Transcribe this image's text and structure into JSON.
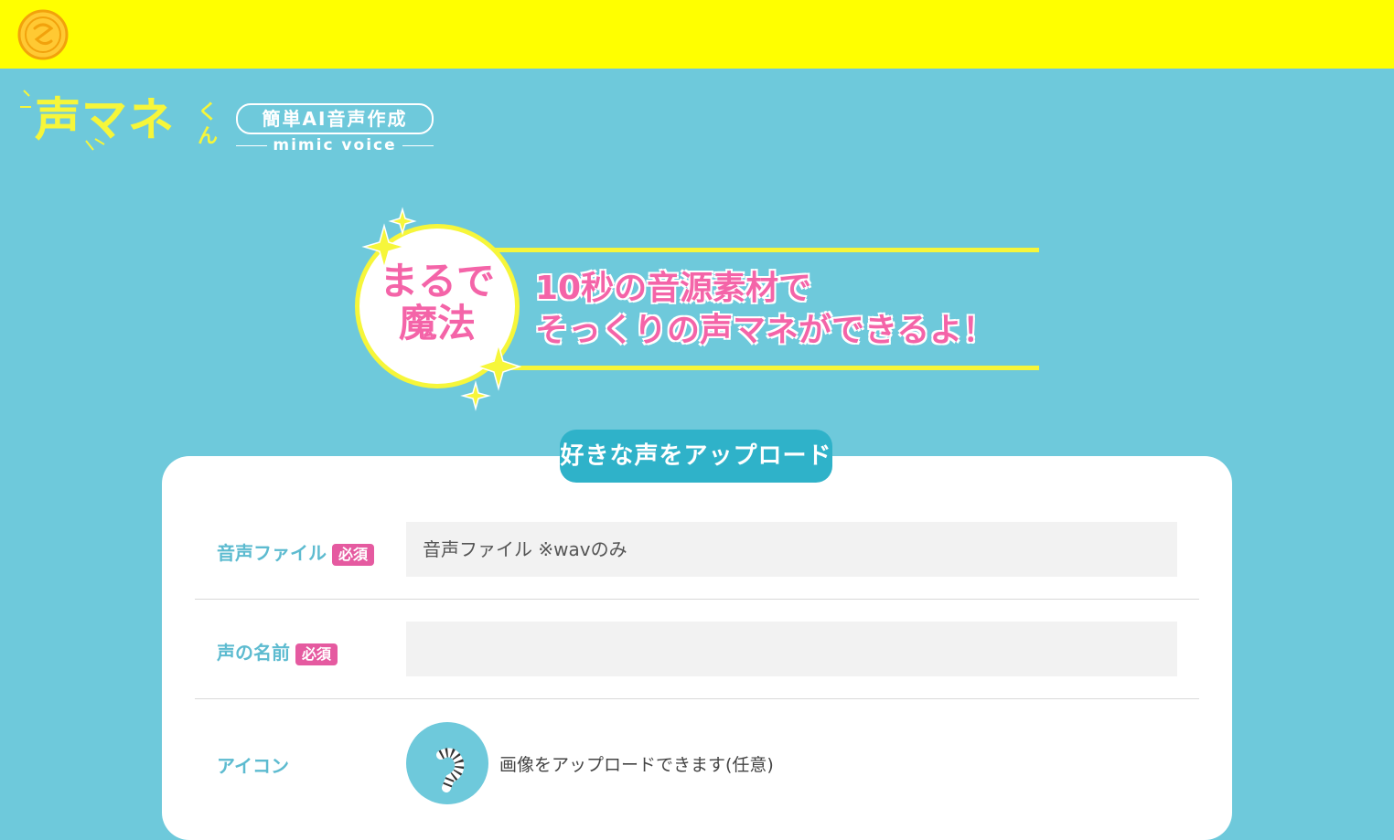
{
  "header": {
    "logo_icon": "swirl-stamp-icon",
    "background": "#ffff00"
  },
  "brand": {
    "title": "声マネ",
    "suffix": "くん",
    "badge": "簡単AI音声作成",
    "subtitle": "mimic voice",
    "color": "#f6f63a"
  },
  "hero": {
    "circle_text": "まるで魔法",
    "line1": "10秒の音源素材で",
    "line2": "そっくりの声マネができるよ！",
    "accent": "#f464a8"
  },
  "upload": {
    "title": "好きな声をアップロード",
    "fields": {
      "audio": {
        "label": "音声ファイル",
        "required": "必須",
        "placeholder": "音声ファイル ※wavのみ"
      },
      "name": {
        "label": "声の名前",
        "required": "必須",
        "value": ""
      },
      "icon": {
        "label": "アイコン",
        "note": "画像をアップロードできます(任意)",
        "icon_name": "default-avatar-icon"
      }
    }
  }
}
